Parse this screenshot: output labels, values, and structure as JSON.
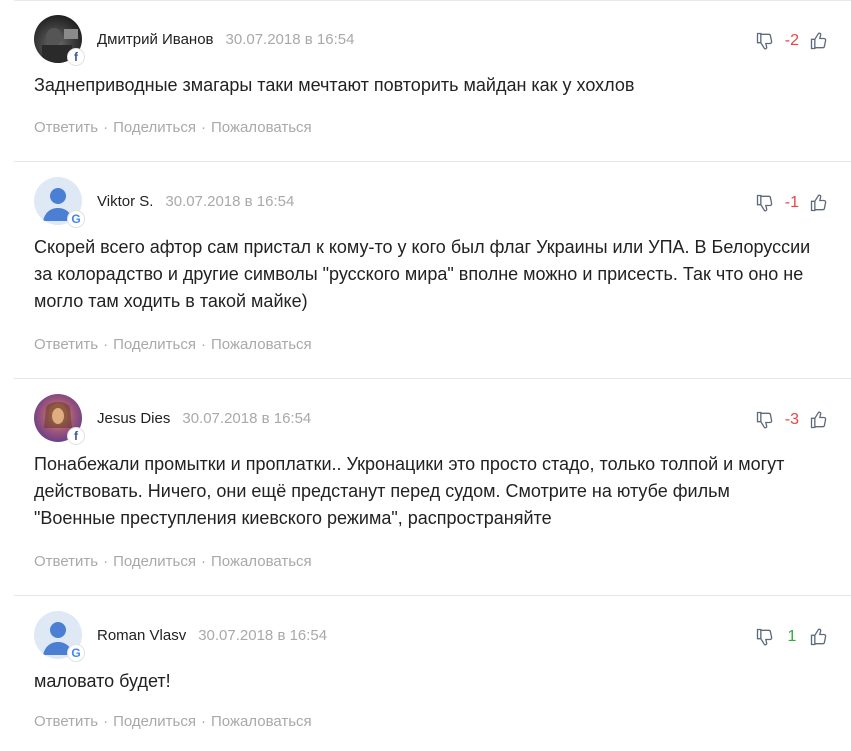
{
  "comments": [
    {
      "author": "Дмитрий Иванов",
      "date": "30.07.2018 в 16:54",
      "avatar": "photo-dark",
      "badge": "f",
      "score": "-2",
      "score_sign": "neg",
      "text": "Заднеприводные змагары таки мечтают повторить майдан как у хохлов"
    },
    {
      "author": "Viktor S.",
      "date": "30.07.2018 в 16:54",
      "avatar": "default",
      "badge": "G",
      "score": "-1",
      "score_sign": "neg",
      "text": "Скорей всего афтор сам пристал к кому-то у кого был флаг Украины или УПА. В Белоруссии за колорадство и другие символы \"русского мира\" вполне можно и присесть. Так что оно не могло там ходить в такой майке)"
    },
    {
      "author": "Jesus Dies",
      "date": "30.07.2018 в 16:54",
      "avatar": "photo-colour",
      "badge": "f",
      "score": "-3",
      "score_sign": "neg",
      "text": "Понабежали промытки и проплатки.. Укронацики это просто стадо, только толпой и могут действовать. Ничего, они ещё предстанут перед судом. Смотрите на ютубе фильм \"Военные преступления киевского режима\", распространяйте"
    },
    {
      "author": "Roman Vlasv",
      "date": "30.07.2018 в 16:54",
      "avatar": "default",
      "badge": "G",
      "score": "1",
      "score_sign": "pos",
      "text": "маловато будет!"
    }
  ],
  "actions": {
    "reply": "Ответить",
    "share": "Поделиться",
    "report": "Пожаловаться",
    "separator": "·"
  },
  "icons": {
    "dislike": "thumbs-down-icon",
    "like": "thumbs-up-icon",
    "facebook": "facebook-icon",
    "google": "google-icon"
  },
  "colors": {
    "negative_score": "#e84545",
    "positive_score": "#37a83c",
    "muted_text": "#a9a9a9"
  }
}
